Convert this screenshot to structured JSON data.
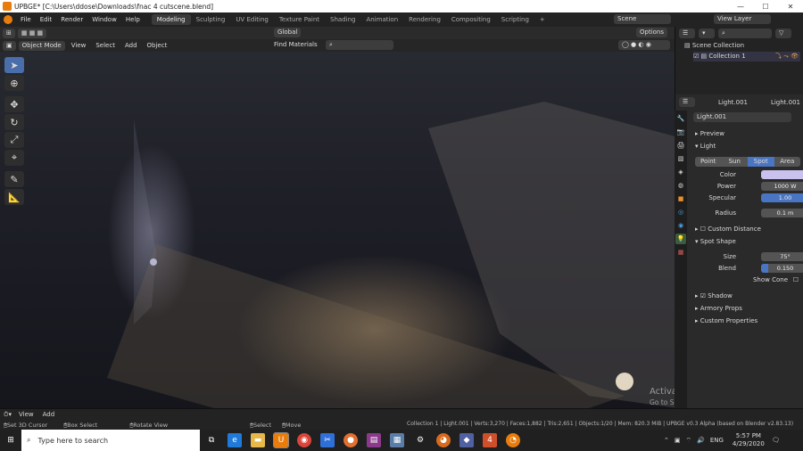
{
  "window": {
    "title": "UPBGE* [C:\\Users\\ddose\\Downloads\\fnac 4 cutscene.blend]",
    "minimize_glyph": "—",
    "maximize_glyph": "☐",
    "close_glyph": "✕"
  },
  "menubar": {
    "menus": [
      "File",
      "Edit",
      "Render",
      "Window",
      "Help"
    ],
    "workspaces": [
      "Modeling",
      "Sculpting",
      "UV Editing",
      "Texture Paint",
      "Shading",
      "Animation",
      "Rendering",
      "Compositing",
      "Scripting"
    ],
    "active_workspace": "Modeling",
    "add_tab_glyph": "+",
    "scene": "Scene",
    "view_layer": "View Layer"
  },
  "viewport_header": {
    "mode": "Object Mode",
    "menus": [
      "View",
      "Select",
      "Add",
      "Object"
    ],
    "transform_orientation": "Global",
    "find_materials": "Find Materials",
    "options": "Options"
  },
  "outliner": {
    "scene_collection": "Scene Collection",
    "collection": "Collection 1"
  },
  "properties": {
    "object_name": "Light.001",
    "data_name": "Light.001",
    "datablock": "Light.001",
    "sections": {
      "preview": "Preview",
      "light": "Light",
      "custom_distance": "Custom Distance",
      "spot_shape": "Spot Shape",
      "shadow": "Shadow",
      "armory_props": "Armory Props",
      "custom_properties": "Custom Properties"
    },
    "light_types": [
      "Point",
      "Sun",
      "Spot",
      "Area"
    ],
    "active_light_type": "Spot",
    "fields": {
      "color_label": "Color",
      "color_value": "#c9c2ee",
      "power_label": "Power",
      "power_value": "1000 W",
      "specular_label": "Specular",
      "specular_value": "1.00",
      "radius_label": "Radius",
      "radius_value": "0.1 m",
      "size_label": "Size",
      "size_value": "75°",
      "blend_label": "Blend",
      "blend_value": "0.150",
      "blend_fraction": 0.15,
      "show_cone_label": "Show Cone"
    }
  },
  "watermark": {
    "line1": "Activate Windows",
    "line2": "Go to Settings to activate Windows."
  },
  "viewport_footer": {
    "view": "View",
    "add": "Add"
  },
  "statusbar": {
    "hints": [
      "Set 3D Cursor",
      "Box Select",
      "Rotate View",
      "Select",
      "Move"
    ],
    "stats": "Collection 1 | Light.001 | Verts:3,270 | Faces:1,882 | Tris:2,651 | Objects:1/20 | Mem: 820.3 MiB | UPBGE v0.3 Alpha (based on Blender v2.83.13)"
  },
  "taskbar": {
    "search_placeholder": "Type here to search",
    "time": "5:57 PM",
    "date": "4/29/2020",
    "lang": "ENG",
    "icons": [
      "task-view-icon",
      "edge-icon",
      "file-explorer-icon",
      "upbge-icon",
      "chrome-icon",
      "snipping-icon",
      "app-icon",
      "winrar-icon",
      "app2-icon",
      "settings-icon",
      "firefox-icon",
      "app3-icon",
      "app4-icon",
      "blender-icon"
    ]
  }
}
